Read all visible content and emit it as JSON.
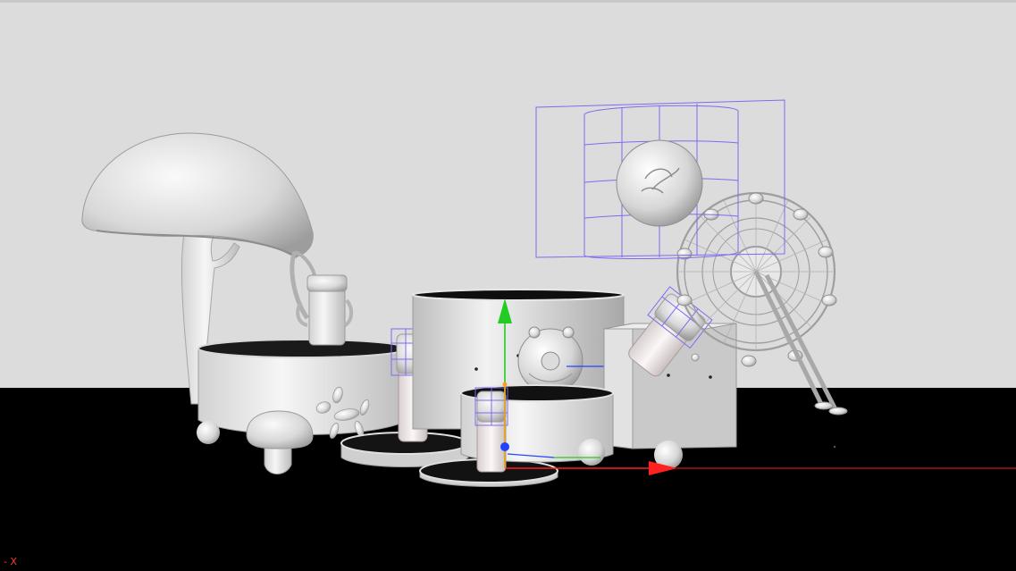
{
  "viewport": {
    "axis_label": "- X",
    "colors": {
      "backdrop": "#dcdcdc",
      "floor": "#000000",
      "selection": "#7b6cf0",
      "x_axis": "#ff2020",
      "y_axis": "#22cc22",
      "z_axis": "#2244ff"
    },
    "selected_objects": [
      "ornament-globe",
      "bottle-on-pedestal",
      "bottle-small",
      "bottle-tilted"
    ]
  }
}
